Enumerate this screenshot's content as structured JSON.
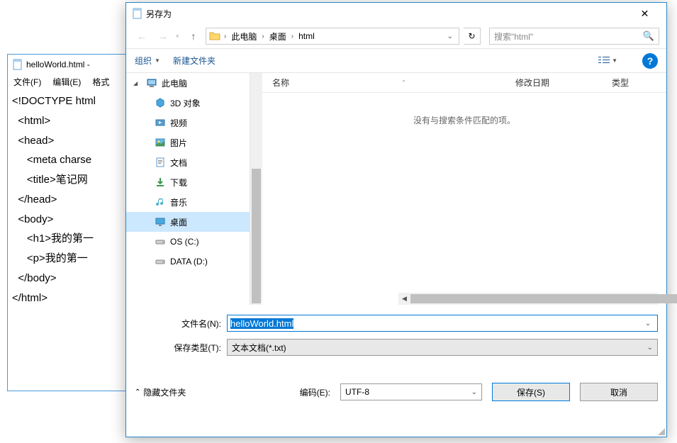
{
  "notepad": {
    "title": "helloWorld.html -",
    "menu": {
      "file": "文件(F)",
      "edit": "编辑(E)",
      "format": "格式"
    },
    "content": "<!DOCTYPE html\n  <html>\n  <head>\n     <meta charse\n     <title>笔记网\n  </head>\n  <body>\n     <h1>我的第一\n     <p>我的第一\n  </body>\n</html>"
  },
  "dialog": {
    "title": "另存为",
    "breadcrumb": {
      "pc": "此电脑",
      "desktop": "桌面",
      "folder": "html"
    },
    "search_placeholder": "搜索\"html\"",
    "toolbar": {
      "organize": "组织",
      "new_folder": "新建文件夹"
    },
    "nav": {
      "pc": "此电脑",
      "items": [
        {
          "label": "3D 对象",
          "icon": "3d"
        },
        {
          "label": "视频",
          "icon": "video"
        },
        {
          "label": "图片",
          "icon": "pic"
        },
        {
          "label": "文档",
          "icon": "doc"
        },
        {
          "label": "下载",
          "icon": "dl"
        },
        {
          "label": "音乐",
          "icon": "music"
        },
        {
          "label": "桌面",
          "icon": "desktop",
          "selected": true
        },
        {
          "label": "OS (C:)",
          "icon": "drive"
        },
        {
          "label": "DATA (D:)",
          "icon": "drive"
        }
      ]
    },
    "columns": {
      "name": "名称",
      "date": "修改日期",
      "type": "类型"
    },
    "empty_text": "没有与搜索条件匹配的项。",
    "filename_label": "文件名(N):",
    "filename_value": "helloWorld.html",
    "filetype_label": "保存类型(T):",
    "filetype_value": "文本文档(*.txt)",
    "hide_folders": "隐藏文件夹",
    "encoding_label": "编码(E):",
    "encoding_value": "UTF-8",
    "save_btn": "保存(S)",
    "cancel_btn": "取消"
  }
}
